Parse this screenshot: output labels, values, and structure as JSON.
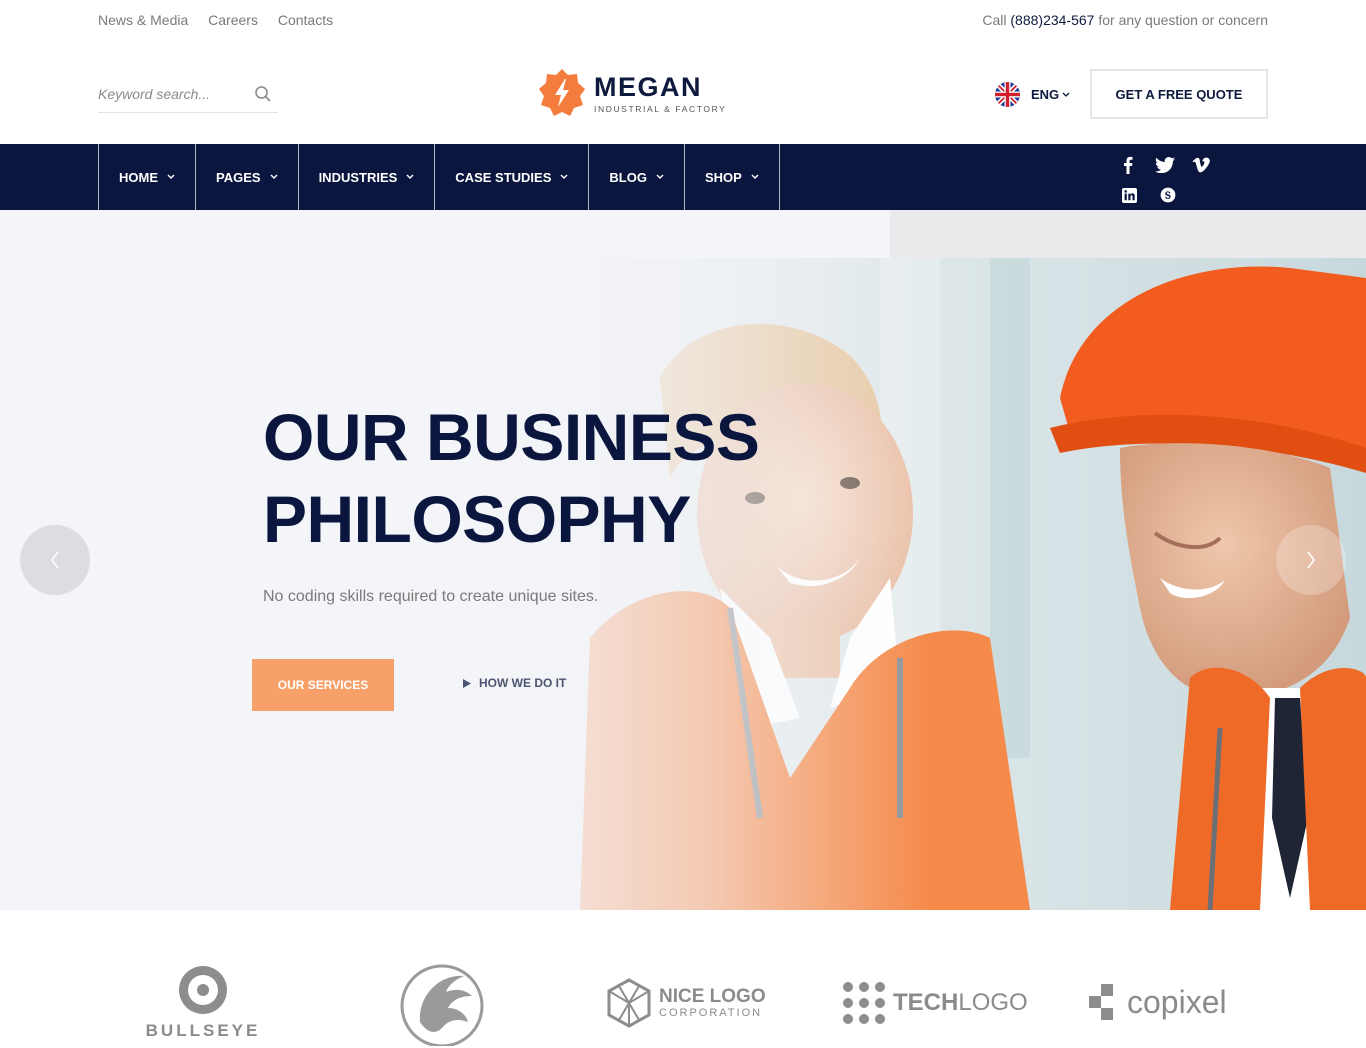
{
  "topbar": {
    "links": [
      "News & Media",
      "Careers",
      "Contacts"
    ],
    "call_prefix": "Call ",
    "phone": "(888)234-567",
    "call_suffix": " for any question or concern"
  },
  "search": {
    "placeholder": "Keyword search..."
  },
  "logo": {
    "name": "MEGAN",
    "tagline": "INDUSTRIAL & FACTORY"
  },
  "language": {
    "selected": "ENG",
    "icon": "uk-flag-icon"
  },
  "quote_button": "GET A FREE QUOTE",
  "nav": {
    "items": [
      "HOME",
      "PAGES",
      "INDUSTRIES",
      "CASE STUDIES",
      "BLOG",
      "SHOP"
    ],
    "social": [
      "facebook-icon",
      "twitter-icon",
      "vimeo-icon",
      "linkedin-icon",
      "skype-icon"
    ]
  },
  "hero": {
    "title_line1": "OUR BUSINESS",
    "title_line2": "PHILOSOPHY",
    "subtitle": "No coding skills required to create unique sites.",
    "primary_button": "OUR SERVICES",
    "secondary_button": "HOW WE DO IT"
  },
  "partners": {
    "bullseye": "BULLSEYE",
    "nicelogo_main": "NICE LOGO",
    "nicelogo_sub": "CORPORATION",
    "techlogo_bold": "TECH",
    "techlogo_light": "LOGO",
    "copixel": "copixel"
  },
  "colors": {
    "navy": "#0b163f",
    "accent": "#f47c3c",
    "button_light": "#f7a06a"
  }
}
